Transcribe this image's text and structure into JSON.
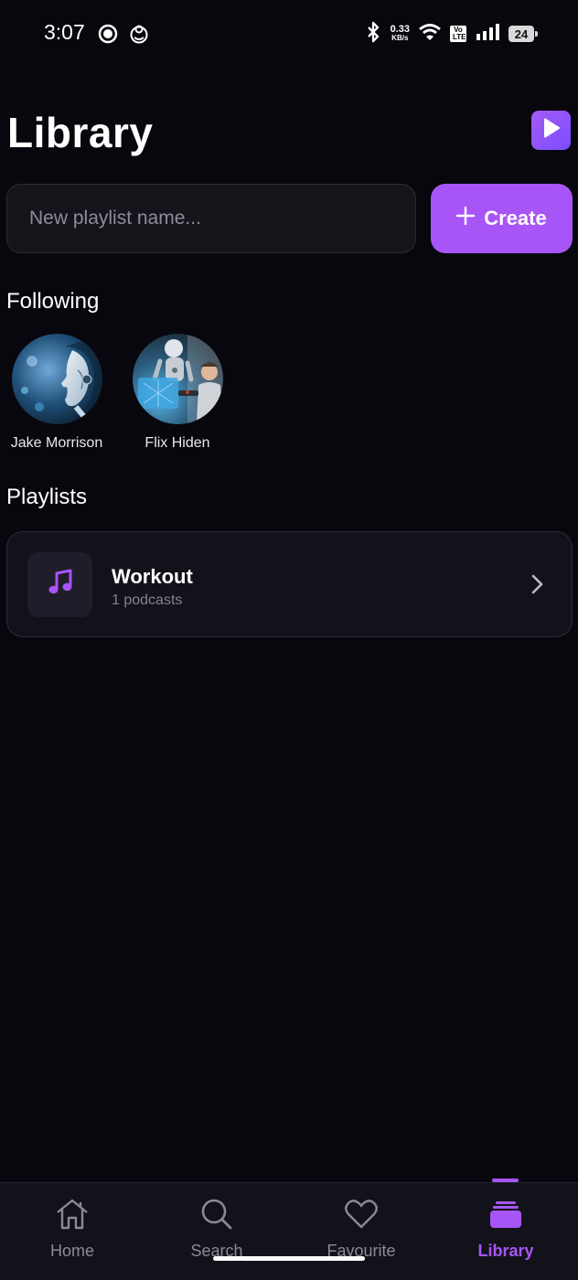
{
  "status_bar": {
    "time": "3:07",
    "net_speed_value": "0.33",
    "net_speed_unit": "KB/s",
    "volte_line1": "Vo",
    "volte_line2": "LTE",
    "battery": "24",
    "icons": [
      "record-icon",
      "baby-icon",
      "bluetooth-icon",
      "wifi-icon",
      "signal-icon",
      "battery-icon"
    ]
  },
  "header": {
    "title": "Library",
    "play_icon": "play-icon"
  },
  "new_playlist": {
    "placeholder": "New playlist name...",
    "value": "",
    "create_label": "Create",
    "create_icon": "plus-icon"
  },
  "following": {
    "title": "Following",
    "items": [
      {
        "name": "Jake Morrison"
      },
      {
        "name": "Flix Hiden"
      }
    ]
  },
  "playlists": {
    "title": "Playlists",
    "items": [
      {
        "name": "Workout",
        "count": "1 podcasts",
        "icon": "music-note-icon"
      }
    ]
  },
  "bottom_nav": {
    "items": [
      {
        "label": "Home",
        "icon": "home-icon"
      },
      {
        "label": "Search",
        "icon": "search-icon"
      },
      {
        "label": "Favourite",
        "icon": "heart-icon"
      },
      {
        "label": "Library",
        "icon": "library-icon"
      }
    ],
    "active": "Library"
  },
  "colors": {
    "background": "#08070d",
    "accent": "#a855f7",
    "card": "#13121a",
    "muted_text": "#8c8996"
  }
}
